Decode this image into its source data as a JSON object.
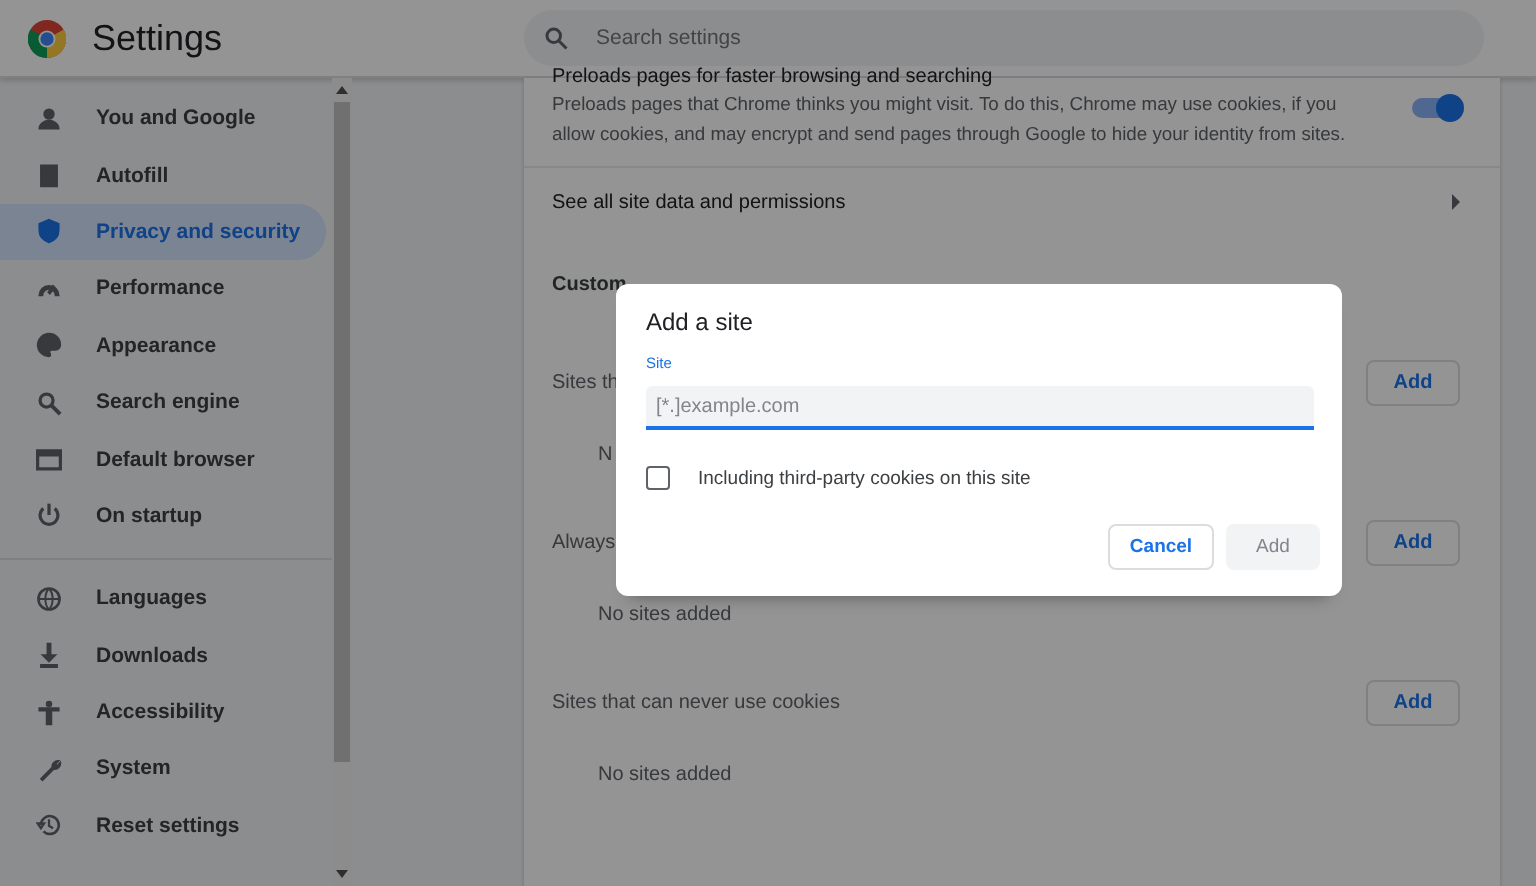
{
  "header": {
    "title": "Settings",
    "search_placeholder": "Search settings"
  },
  "sidebar": {
    "groups": [
      [
        {
          "label": "You and Google",
          "selected": false
        },
        {
          "label": "Autofill",
          "selected": false
        },
        {
          "label": "Privacy and security",
          "selected": true
        },
        {
          "label": "Performance",
          "selected": false
        },
        {
          "label": "Appearance",
          "selected": false
        },
        {
          "label": "Search engine",
          "selected": false
        },
        {
          "label": "Default browser",
          "selected": false
        },
        {
          "label": "On startup",
          "selected": false
        }
      ],
      [
        {
          "label": "Languages",
          "selected": false
        },
        {
          "label": "Downloads",
          "selected": false
        },
        {
          "label": "Accessibility",
          "selected": false
        },
        {
          "label": "System",
          "selected": false
        },
        {
          "label": "Reset settings",
          "selected": false
        }
      ]
    ]
  },
  "content": [
    {
      "kind": "toggle",
      "title": "Preloads pages for faster browsing and searching",
      "description": "Preloads pages that Chrome thinks you might visit. To do this, Chrome may use cookies, if you allow cookies, and may encrypt and send pages through Google to hide your identity from sites.",
      "on": true
    },
    {
      "kind": "link",
      "label": "See all site data and permissions"
    },
    {
      "kind": "heading",
      "label": "Custom"
    },
    {
      "kind": "sites",
      "label": "Sites th",
      "button": "Add",
      "empty": "N"
    },
    {
      "kind": "sites",
      "label": "Always",
      "button": "Add",
      "empty": "No sites added"
    },
    {
      "kind": "sites",
      "label": "Sites that can never use cookies",
      "button": "Add",
      "empty": "No sites added"
    }
  ],
  "dialog": {
    "title": "Add a site",
    "field_label": "Site",
    "placeholder": "[*.]example.com",
    "checkbox": {
      "label": "Including third-party cookies on this site",
      "checked": false
    },
    "buttons": [
      {
        "label": "Cancel",
        "kind": "secondary",
        "disabled": false
      },
      {
        "label": "Add",
        "kind": "primary",
        "disabled": true
      }
    ]
  }
}
